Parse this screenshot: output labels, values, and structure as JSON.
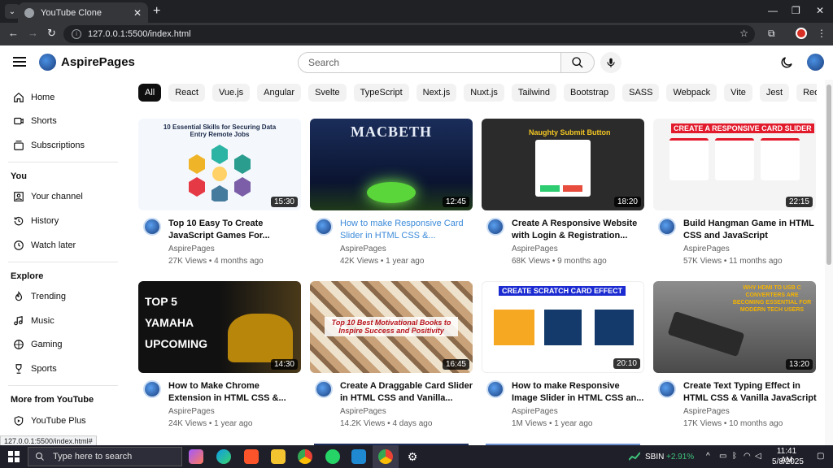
{
  "browser": {
    "tab_title": "YouTube Clone",
    "url": "127.0.0.1:5500/index.html",
    "status_url": "127.0.0.1:5500/index.html#"
  },
  "header": {
    "brand": "AspirePages",
    "search_placeholder": "Search"
  },
  "sidebar": {
    "main": [
      {
        "label": "Home",
        "icon": "home-icon"
      },
      {
        "label": "Shorts",
        "icon": "shorts-icon"
      },
      {
        "label": "Subscriptions",
        "icon": "subscriptions-icon"
      }
    ],
    "you_heading": "You",
    "you": [
      {
        "label": "Your channel",
        "icon": "channel-icon"
      },
      {
        "label": "History",
        "icon": "history-icon"
      },
      {
        "label": "Watch later",
        "icon": "watch-later-icon"
      }
    ],
    "explore_heading": "Explore",
    "explore": [
      {
        "label": "Trending",
        "icon": "trending-icon"
      },
      {
        "label": "Music",
        "icon": "music-icon"
      },
      {
        "label": "Gaming",
        "icon": "gaming-icon"
      },
      {
        "label": "Sports",
        "icon": "sports-icon"
      }
    ],
    "more_heading": "More from YouTube",
    "more": [
      {
        "label": "YouTube Plus",
        "icon": "youtube-plus-icon"
      }
    ]
  },
  "chips": [
    "All",
    "React",
    "Vue.js",
    "Angular",
    "Svelte",
    "TypeScript",
    "Next.js",
    "Nuxt.js",
    "Tailwind",
    "Bootstrap",
    "SASS",
    "Webpack",
    "Vite",
    "Jest",
    "Redux"
  ],
  "videos": [
    {
      "title": "Top 10 Easy To Create JavaScript Games For...",
      "channel": "AspirePages",
      "meta": "27K Views • 4 months ago",
      "duration": "15:30",
      "thumb_text": "10 Essential Skills for Securing Data Entry Remote Jobs"
    },
    {
      "title": "How to make Responsive Card Slider in HTML CSS &...",
      "channel": "AspirePages",
      "meta": "42K Views • 1 year ago",
      "duration": "12:45",
      "thumb_text": "MACBETH"
    },
    {
      "title": "Create A Responsive Website with Login & Registration...",
      "channel": "AspirePages",
      "meta": "68K Views • 9 months ago",
      "duration": "18:20",
      "thumb_text": "Naughty Submit Button"
    },
    {
      "title": "Build Hangman Game in HTML CSS and JavaScript",
      "channel": "AspirePages",
      "meta": "57K Views • 11 months ago",
      "duration": "22:15",
      "thumb_text": "CREATE A RESPONSIVE CARD SLIDER"
    },
    {
      "title": "How to Make Chrome Extension in HTML CSS &...",
      "channel": "AspirePages",
      "meta": "24K Views • 1 year ago",
      "duration": "14:30",
      "thumb_text": "TOP 5 YAMAHA UPCOMING"
    },
    {
      "title": "Create A Draggable Card Slider in HTML CSS and Vanilla...",
      "channel": "AspirePages",
      "meta": "14.2K Views • 4 days ago",
      "duration": "16:45",
      "thumb_text": "Top 10 Best Motivational Books to Inspire Success and Positivity"
    },
    {
      "title": "How to make Responsive Image Slider in HTML CSS an...",
      "channel": "AspirePages",
      "meta": "1M Views • 1 year ago",
      "duration": "20:10",
      "thumb_text": "CREATE SCRATCH CARD EFFECT"
    },
    {
      "title": "Create Text Typing Effect in HTML CSS & Vanilla JavaScript",
      "channel": "AspirePages",
      "meta": "17K Views • 10 months ago",
      "duration": "13:20",
      "thumb_text": "WHY HDMI TO USB C CONVERTERS ARE BECOMING ESSENTIAL FOR MODERN TECH USERS"
    }
  ],
  "taskbar": {
    "search_placeholder": "Type here to search",
    "stock_name": "SBIN",
    "stock_change": "+2.91%",
    "time": "11:41 AM",
    "date": "5/8/2025"
  },
  "colors": {
    "accent": "#0f0f0f",
    "link": "#3d8bd9",
    "stock_up": "#3fc27a"
  }
}
